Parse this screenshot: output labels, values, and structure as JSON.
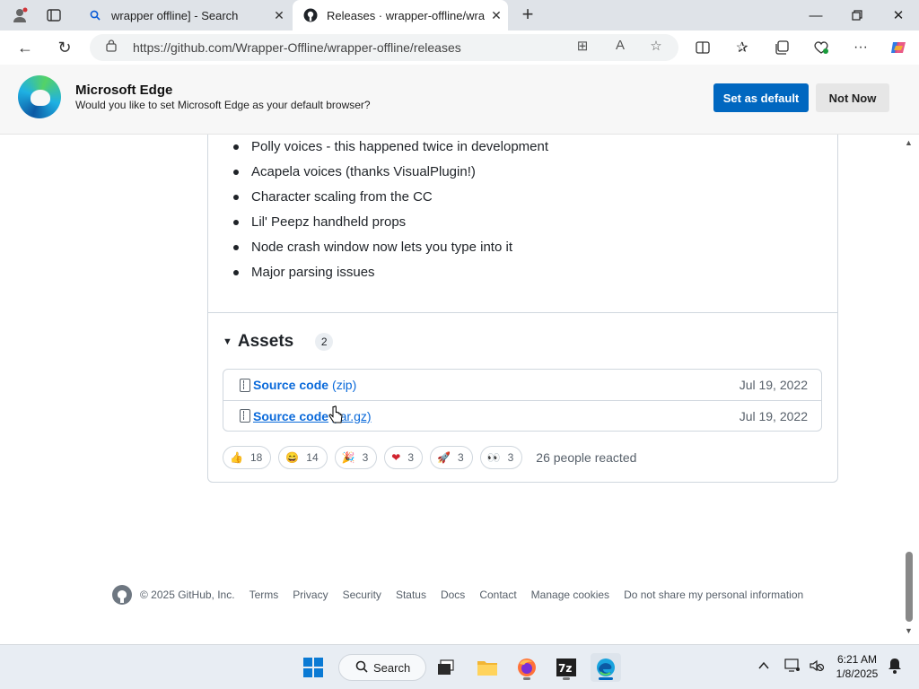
{
  "browser": {
    "tabs": [
      {
        "title": "wrapper offline] - Search",
        "icon": "search-icon",
        "active": false
      },
      {
        "title": "Releases · wrapper-offline/wrapper-offline",
        "icon": "github-icon",
        "active": true
      }
    ],
    "url": "https://github.com/Wrapper-Offline/wrapper-offline/releases"
  },
  "banner": {
    "title": "Microsoft Edge",
    "subtitle": "Would you like to set Microsoft Edge as your default browser?",
    "primary_label": "Set as default",
    "secondary_label": "Not Now"
  },
  "release": {
    "bullets": [
      "Polly voices - this happened twice in development",
      "Acapela voices (thanks VisualPlugin!)",
      "Character scaling from the CC",
      "Lil' Peepz handheld props",
      "Node crash window now lets you type into it",
      "Major parsing issues"
    ],
    "assets_title": "Assets",
    "assets_count": "2",
    "assets": [
      {
        "name": "Source code",
        "ext": "(zip)",
        "date": "Jul 19, 2022"
      },
      {
        "name": "Source code",
        "ext": "(tar.gz)",
        "date": "Jul 19, 2022"
      }
    ],
    "reactions": [
      {
        "emoji": "👍",
        "count": "18",
        "icon": "thumbs-up-icon"
      },
      {
        "emoji": "😄",
        "count": "14",
        "icon": "laugh-icon"
      },
      {
        "emoji": "🎉",
        "count": "3",
        "icon": "hooray-icon"
      },
      {
        "emoji": "❤",
        "count": "3",
        "icon": "heart-icon"
      },
      {
        "emoji": "🚀",
        "count": "3",
        "icon": "rocket-icon"
      },
      {
        "emoji": "👀",
        "count": "3",
        "icon": "eyes-icon"
      }
    ],
    "reactions_summary": "26 people reacted"
  },
  "footer": {
    "copyright": "© 2025 GitHub, Inc.",
    "links": [
      "Terms",
      "Privacy",
      "Security",
      "Status",
      "Docs",
      "Contact",
      "Manage cookies",
      "Do not share my personal information"
    ]
  },
  "taskbar": {
    "search_label": "Search",
    "time": "6:21 AM",
    "date": "1/8/2025"
  },
  "colors": {
    "link": "#0969da",
    "primary_button": "#0067c0",
    "muted_text": "#57606a"
  }
}
